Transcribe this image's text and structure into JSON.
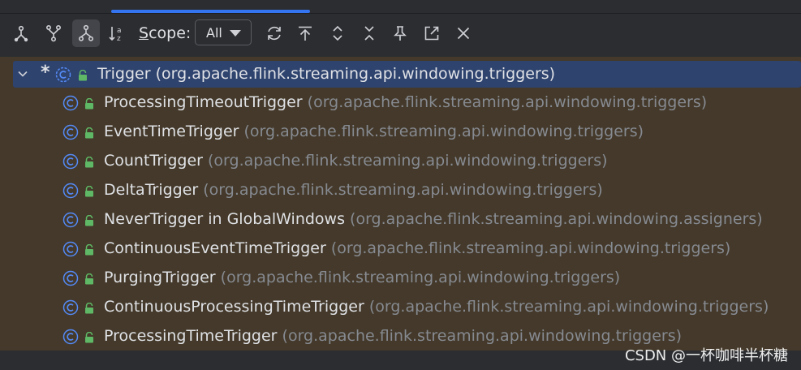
{
  "toolbar": {
    "scope_label_first": "S",
    "scope_label_rest": "cope:",
    "scope_value": "All",
    "buttons": [
      {
        "name": "supertypes-hierarchy-icon"
      },
      {
        "name": "subtypes-hierarchy-icon"
      },
      {
        "name": "class-hierarchy-icon",
        "active": true
      },
      {
        "name": "sort-alphabetically-icon"
      },
      {
        "name": "refresh-icon"
      },
      {
        "name": "base-on-this-class-icon"
      },
      {
        "name": "expand-all-icon"
      },
      {
        "name": "collapse-all-icon"
      },
      {
        "name": "pin-tab-icon"
      },
      {
        "name": "open-in-editor-icon"
      },
      {
        "name": "close-icon"
      }
    ]
  },
  "tree": {
    "root": {
      "marker": "*",
      "name": "Trigger",
      "package": "(org.apache.flink.streaming.api.windowing.triggers)"
    },
    "children": [
      {
        "name": "ProcessingTimeoutTrigger",
        "package": "(org.apache.flink.streaming.api.windowing.triggers)"
      },
      {
        "name": "EventTimeTrigger",
        "package": "(org.apache.flink.streaming.api.windowing.triggers)"
      },
      {
        "name": "CountTrigger",
        "package": "(org.apache.flink.streaming.api.windowing.triggers)"
      },
      {
        "name": "DeltaTrigger",
        "package": "(org.apache.flink.streaming.api.windowing.triggers)"
      },
      {
        "name": "NeverTrigger in GlobalWindows",
        "package": "(org.apache.flink.streaming.api.windowing.assigners)"
      },
      {
        "name": "ContinuousEventTimeTrigger",
        "package": "(org.apache.flink.streaming.api.windowing.triggers)"
      },
      {
        "name": "PurgingTrigger",
        "package": "(org.apache.flink.streaming.api.windowing.triggers)"
      },
      {
        "name": "ContinuousProcessingTimeTrigger",
        "package": "(org.apache.flink.streaming.api.windowing.triggers)"
      },
      {
        "name": "ProcessingTimeTrigger",
        "package": "(org.apache.flink.streaming.api.windowing.triggers)"
      }
    ]
  },
  "watermark": "CSDN @一杯咖啡半杯糖",
  "colors": {
    "accent": "#3574f0",
    "selection": "#2e436e",
    "tree_background": "#44392a",
    "class_icon": "#548af7",
    "lock_icon": "#5fb865",
    "package_text": "#868a91"
  }
}
